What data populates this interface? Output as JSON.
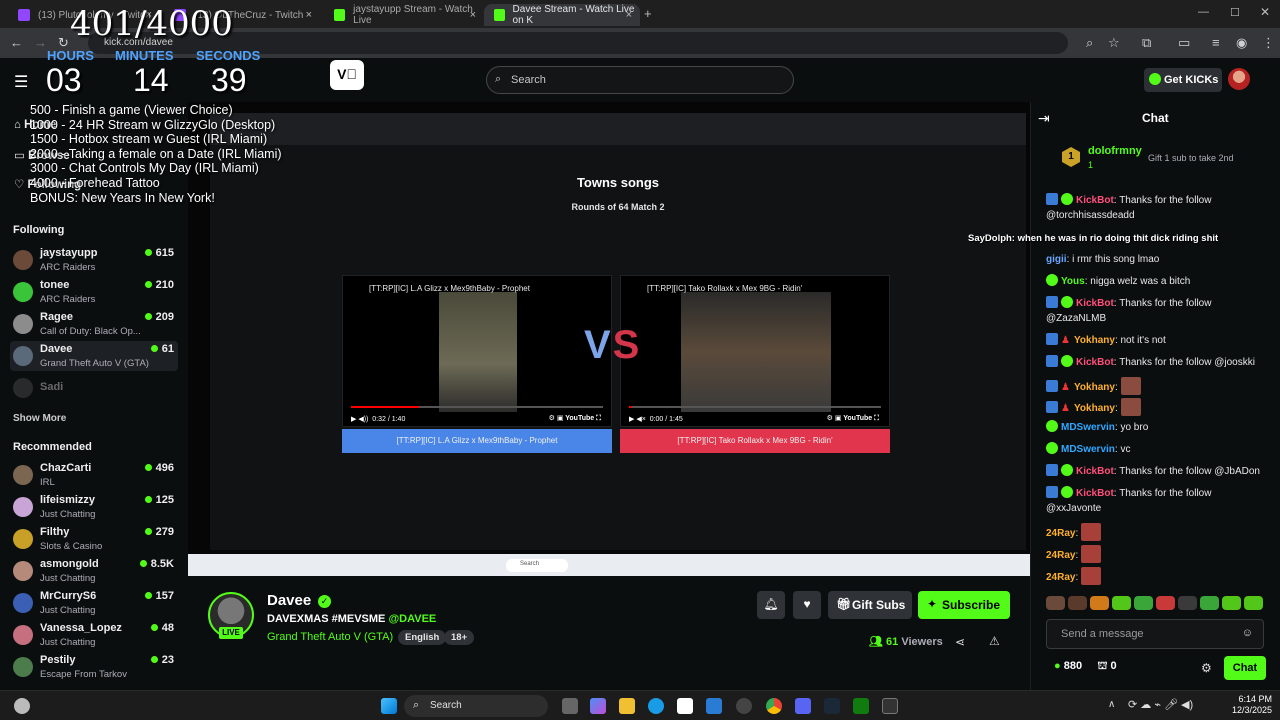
{
  "tabs": [
    {
      "label": "(13) Plutooolemy - Twitch",
      "close": "×"
    },
    {
      "label": "(13) ObTheCruz - Twitch",
      "close": "×"
    },
    {
      "label": "jaystayupp Stream - Watch Live",
      "close": "×"
    },
    {
      "label": "Davee Stream - Watch Live on K",
      "close": "×"
    }
  ],
  "address": {
    "url": "kick.com/davee"
  },
  "overlay": {
    "counter": "401/4000",
    "hours_label": "HOURS",
    "minutes_label": "MINUTES",
    "seconds_label": "SECONDS",
    "hours": "03",
    "minutes": "14",
    "seconds": "39",
    "goals": [
      "500 -  Finish a game (Viewer Choice)",
      "1000 - 24 HR Stream w GlizzyGlo (Desktop)",
      "1500 - Hotbox stream w Guest (IRL Miami)",
      "2000 - Taking a female on a Date (IRL Miami)",
      "3000 - Chat Controls My Day (IRL Miami)",
      "4000 - Forehead Tattoo",
      "BONUS: New Years In New York!"
    ]
  },
  "header": {
    "search_placeholder": "Search",
    "get_kicks": "Get KICKs"
  },
  "sidebar": {
    "nav": [
      "Home",
      "Browse",
      "Following"
    ],
    "following_title": "Following",
    "following": [
      {
        "name": "jaystayupp",
        "game": "ARC Raiders",
        "viewers": "615"
      },
      {
        "name": "tonee",
        "game": "ARC Raiders",
        "viewers": "210"
      },
      {
        "name": "Ragee",
        "game": "Call of Duty: Black Op...",
        "viewers": "209"
      },
      {
        "name": "Davee",
        "game": "Grand Theft Auto V (GTA)",
        "viewers": "61"
      },
      {
        "name": "Sadi",
        "game": "",
        "viewers": ""
      }
    ],
    "show_more": "Show More",
    "recommended_title": "Recommended",
    "recommended": [
      {
        "name": "ChazCarti",
        "game": "IRL",
        "viewers": "496"
      },
      {
        "name": "lifeismizzy",
        "game": "Just Chatting",
        "viewers": "125"
      },
      {
        "name": "Filthy",
        "game": "Slots & Casino",
        "viewers": "279"
      },
      {
        "name": "asmongold",
        "game": "Just Chatting",
        "viewers": "8.5K"
      },
      {
        "name": "MrCurryS6",
        "game": "Just Chatting",
        "viewers": "157"
      },
      {
        "name": "Vanessa_Lopez",
        "game": "Just Chatting",
        "viewers": "48"
      },
      {
        "name": "Pestily",
        "game": "Escape From Tarkov",
        "viewers": "23"
      }
    ]
  },
  "stream": {
    "inner_title": "Towns songs",
    "inner_subtitle": "Rounds of 64 Match 2",
    "video_left_title": "[TT:RP][IC] L.A Glizz x Mex9thBaby - Prophet",
    "video_right_title": "[TT:RP][IC] Tako Rollaxk x Mex 9BG - Ridin'",
    "left_time": "0:32 / 1:40",
    "right_time": "0:00 / 1:45",
    "vs": "VS",
    "choice_left": "[TT:RP][IC] L.A Glizz x Mex9thBaby - Prophet",
    "choice_right": "[TT:RP][IC] Tako Rollaxk x Mex 9BG - Ridin'",
    "taskbar_search": "Search"
  },
  "info": {
    "name": "Davee",
    "live": "LIVE",
    "title_prefix": "DAVEXMAS  #MEVSME ",
    "title_mention": "@DAVEE",
    "category": "Grand Theft Auto V (GTA)",
    "tags": [
      "English",
      "18+"
    ],
    "gift_subs": "Gift Subs",
    "subscribe": "Subscribe",
    "viewers": "61",
    "viewers_label": "Viewers"
  },
  "chat": {
    "title": "Chat",
    "pinned_user": "dolofrmny",
    "pinned_count": "1",
    "pinned_text": "Gift 1 sub to take 2nd",
    "messages": [
      {
        "user": "KickBot",
        "color": "#ff4f7a",
        "text": "Thanks for the follow @torchhisassdeadd"
      },
      {
        "user": "gigii",
        "color": "#6aa5ff",
        "text": "i rmr this song lmao"
      },
      {
        "user": "Yous",
        "color": "#53fc18",
        "text": "nigga welz was a bitch"
      },
      {
        "user": "KickBot",
        "color": "#ff4f7a",
        "text": "Thanks for the follow @ZazaNLMB"
      },
      {
        "user": "Yokhany",
        "color": "#ffb02e",
        "text": "not it's not"
      },
      {
        "user": "KickBot",
        "color": "#ff4f7a",
        "text": "Thanks for the follow @jooskki"
      },
      {
        "user": "Yokhany",
        "color": "#ffb02e",
        "text": ""
      },
      {
        "user": "Yokhany",
        "color": "#ffb02e",
        "text": ""
      },
      {
        "user": "MDSwervin",
        "color": "#2ea8ff",
        "text": "yo bro"
      },
      {
        "user": "MDSwervin",
        "color": "#2ea8ff",
        "text": "vc"
      },
      {
        "user": "KickBot",
        "color": "#ff4f7a",
        "text": "Thanks for the follow @JbADon"
      },
      {
        "user": "KickBot",
        "color": "#ff4f7a",
        "text": "Thanks for the follow @xxJavonte"
      },
      {
        "user": "24Ray",
        "color": "#ffb02e",
        "text": ""
      },
      {
        "user": "24Ray",
        "color": "#ffb02e",
        "text": ""
      },
      {
        "user": "24Ray",
        "color": "#ffb02e",
        "text": ""
      }
    ],
    "overlay_msg": "SayDolph: when he was in rio doing thit dick riding shit",
    "input_placeholder": "Send a message",
    "points": "880",
    "drops": "0",
    "send": "Chat"
  },
  "taskbar": {
    "search": "Search",
    "time": "6:14 PM",
    "date": "12/3/2025"
  }
}
